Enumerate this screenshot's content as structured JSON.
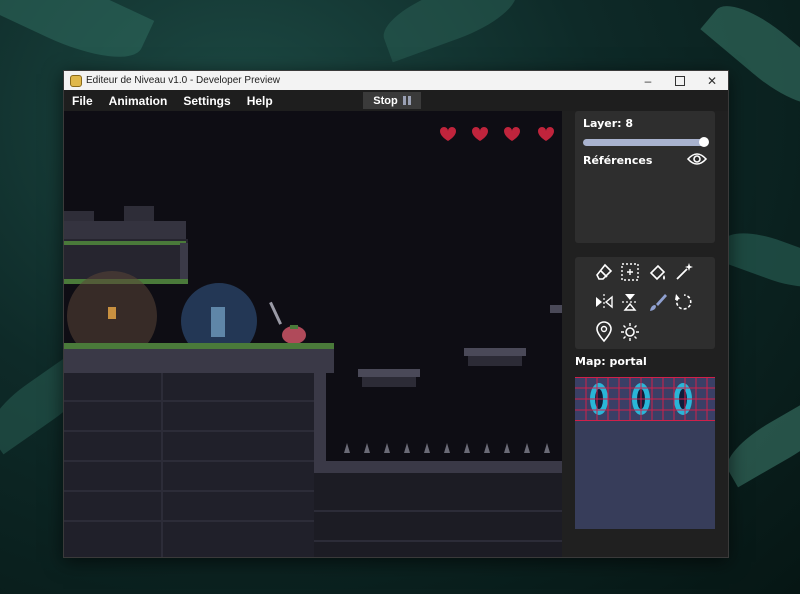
{
  "window": {
    "title": "Editeur de Niveau v1.0 - Developer Preview",
    "controls": [
      "minimize",
      "maximize",
      "close"
    ]
  },
  "menu": {
    "items": [
      "File",
      "Animation",
      "Settings",
      "Help"
    ],
    "stop_label": "Stop"
  },
  "game": {
    "hearts": 4,
    "colors": {
      "background": "#0e0d14",
      "stone": "#3a3a4a",
      "moss": "#4a7a3a",
      "heart": "#c0243c"
    }
  },
  "panel": {
    "layer_label": "Layer: 8",
    "layer_slider_fraction": 0.98,
    "references_label": "Références",
    "map_label": "Map: portal"
  },
  "tools": [
    "eraser-icon",
    "select-icon",
    "fill-icon",
    "sparkle-icon",
    "flip-horizontal-icon",
    "flip-vertical-icon",
    "brush-icon",
    "rotate-icon",
    "location-pin-icon",
    "sun-icon"
  ],
  "colors": {
    "accent": "#a9b3cf",
    "panel": "#2e2e2e",
    "map_bg": "#373d5a",
    "grid": "#d0204a"
  }
}
